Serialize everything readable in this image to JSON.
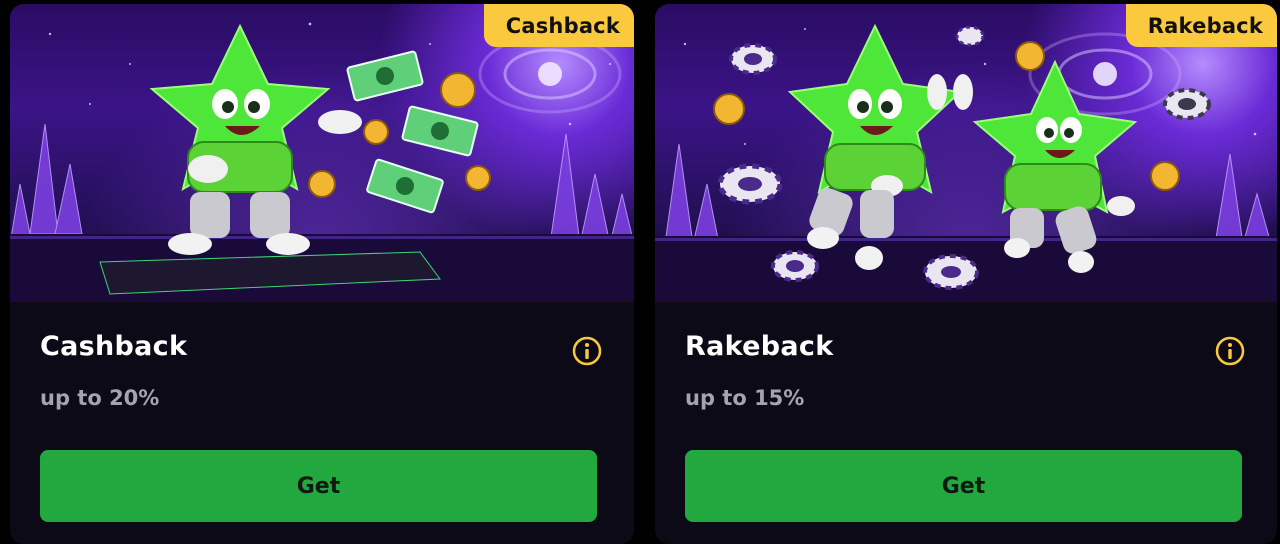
{
  "cards": [
    {
      "badge": "Cashback",
      "title": "Cashback",
      "subtitle": "up to 20%",
      "button_label": "Get",
      "illustration": "green-star-mascot-with-money"
    },
    {
      "badge": "Rakeback",
      "title": "Rakeback",
      "subtitle": "up to 15%",
      "button_label": "Get",
      "illustration": "two-green-star-mascots-high-five-with-poker-chips"
    }
  ],
  "colors": {
    "background": "#000000",
    "card": "#0c0a16",
    "badge": "#fbc93d",
    "button": "#22a83f",
    "info_icon": "#fbc93d",
    "mascot": "#4fe63a"
  }
}
